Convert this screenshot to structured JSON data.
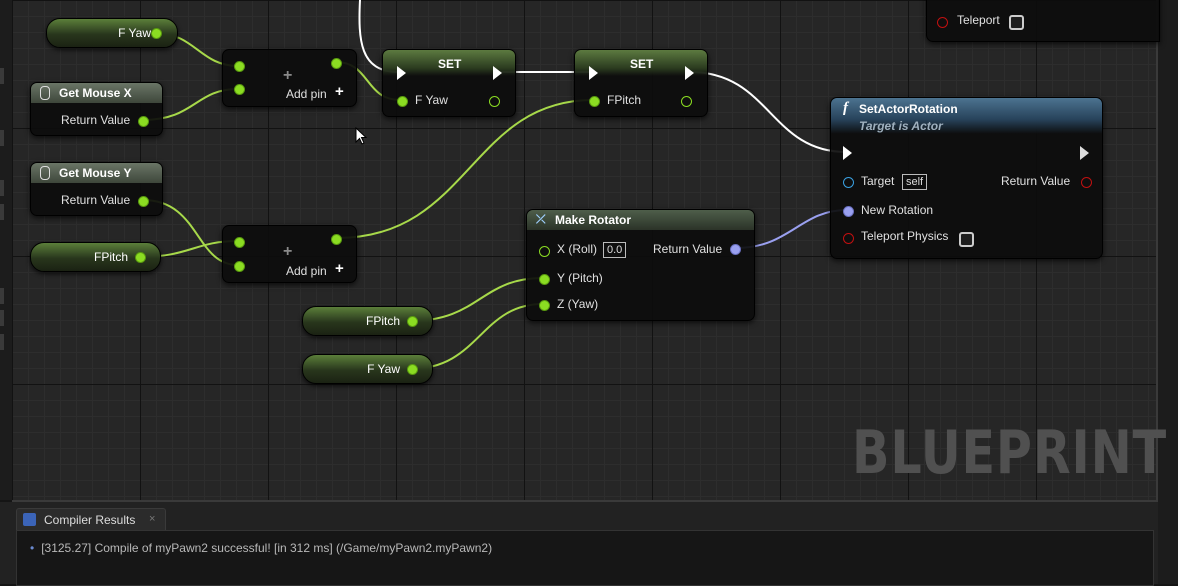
{
  "nodes": {
    "fyaw_var_top": {
      "label": "F Yaw"
    },
    "get_mouse_x": {
      "title": "Get Mouse X",
      "return_label": "Return Value"
    },
    "get_mouse_y": {
      "title": "Get Mouse Y",
      "return_label": "Return Value"
    },
    "fpitch_var_left": {
      "label": "FPitch"
    },
    "add_top": {
      "add_pin_label": "Add pin"
    },
    "add_bottom": {
      "add_pin_label": "Add pin"
    },
    "set_yaw": {
      "title": "SET",
      "pin_label": "F Yaw"
    },
    "set_pitch": {
      "title": "SET",
      "pin_label": "FPitch"
    },
    "set_actor_rotation": {
      "title": "SetActorRotation",
      "subtitle": "Target is Actor",
      "target_label": "Target",
      "target_value": "self",
      "return_label": "Return Value",
      "new_rotation_label": "New Rotation",
      "teleport_label": "Teleport Physics"
    },
    "make_rotator": {
      "title": "Make Rotator",
      "roll_label": "X (Roll)",
      "roll_value": "0.0",
      "pitch_label": "Y (Pitch)",
      "yaw_label": "Z (Yaw)",
      "return_label": "Return Value"
    },
    "fpitch_var_bottom": {
      "label": "FPitch"
    },
    "fyaw_var_bottom": {
      "label": "F Yaw"
    },
    "teleport_node": {
      "label": "Teleport"
    }
  },
  "watermark": "BLUEPRINT",
  "compiler": {
    "tab_label": "Compiler Results",
    "close": "×",
    "message": "[3125.27] Compile of myPawn2 successful! [in 312 ms] (/Game/myPawn2.myPawn2)",
    "bullet": "•"
  },
  "colors": {
    "float_pin": "#8bdc22",
    "rotator_pin": "#9aa0f0",
    "exec_wire": "#ffffff",
    "function_header": "#2f4f6a",
    "pure_header": "#4c5a48"
  }
}
